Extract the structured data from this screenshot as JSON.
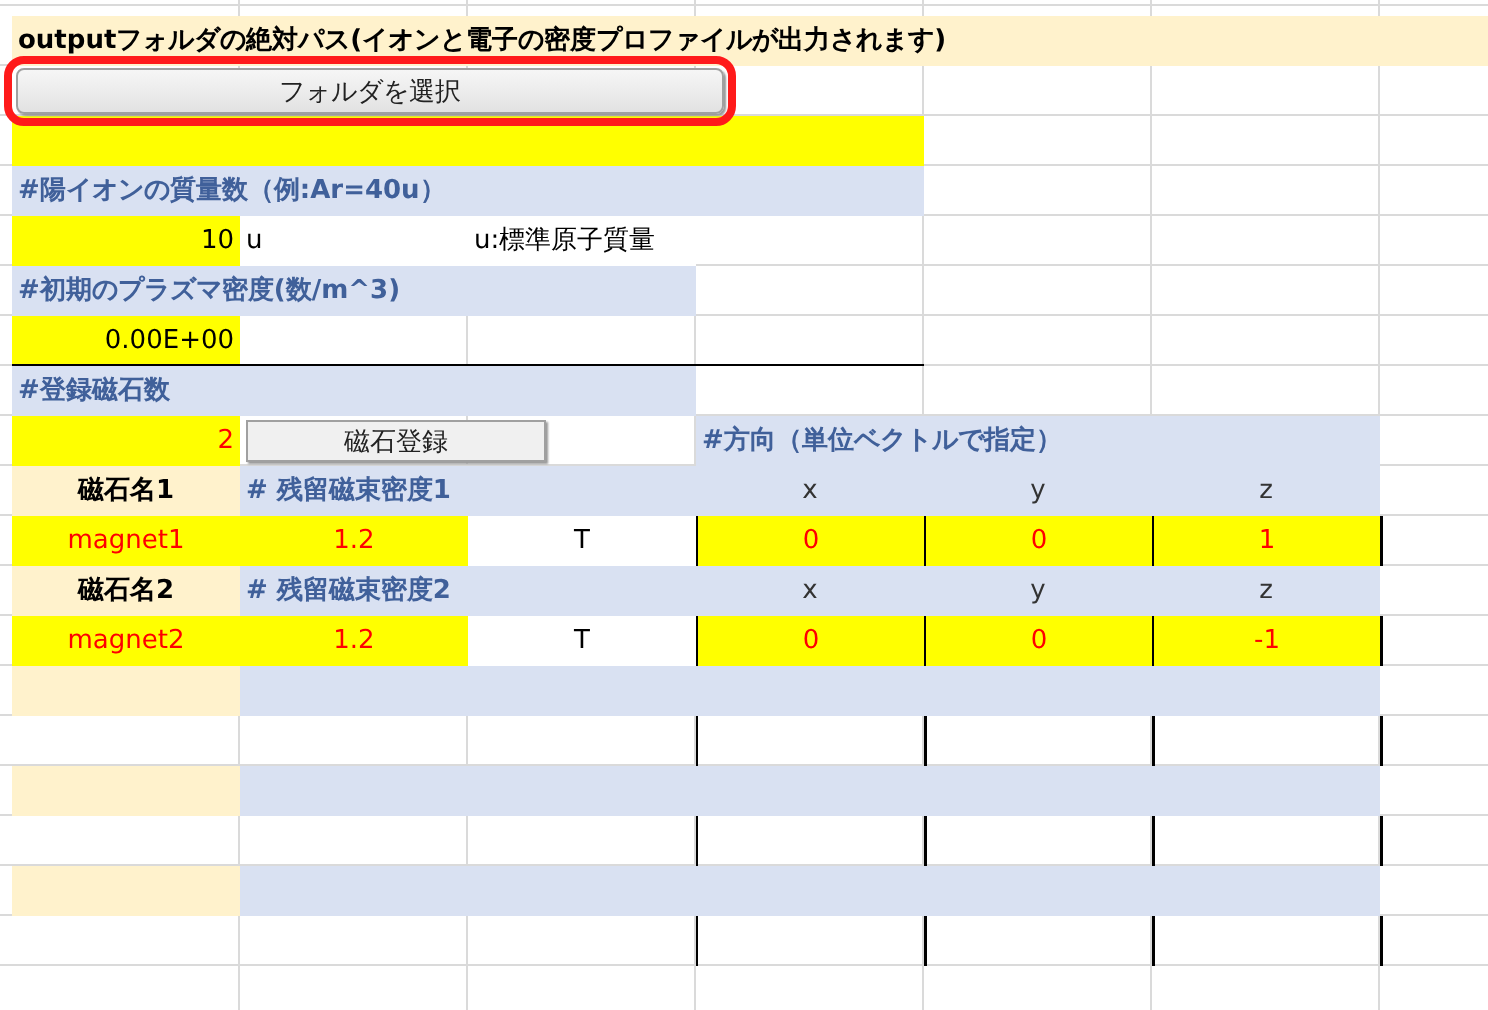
{
  "sheet": {
    "rows": [
      {
        "cells": [
          {
            "kind": "title",
            "text": "outputフォルダの絶対パス(イオンと電子の密度プロファイルが出力されます)"
          },
          {
            "kind": "title"
          },
          {
            "kind": "title"
          },
          {
            "kind": "title"
          },
          {
            "kind": "title"
          },
          {
            "kind": "title"
          },
          {
            "kind": "title"
          }
        ]
      },
      {
        "button": {
          "kind": "folder",
          "label": "フォルダを選択",
          "highlighted": true
        }
      },
      {
        "cells": [
          {
            "kind": "input"
          },
          {
            "kind": "input"
          },
          {
            "kind": "input"
          },
          {
            "kind": "input"
          }
        ]
      },
      {
        "cells": [
          {
            "kind": "header",
            "text": "#陽イオンの質量数（例:Ar=40u）"
          },
          {
            "kind": "header"
          },
          {
            "kind": "header"
          },
          {
            "kind": "header"
          }
        ]
      },
      {
        "cells": [
          {
            "kind": "input",
            "text": "10"
          },
          {
            "kind": "text",
            "text": "u"
          },
          {
            "kind": "text",
            "text": "u:標準原子質量"
          }
        ]
      },
      {
        "cells": [
          {
            "kind": "header",
            "text": "#初期のプラズマ密度(数/m^3)"
          },
          {
            "kind": "header"
          },
          {
            "kind": "header"
          }
        ]
      },
      {
        "cells": [
          {
            "kind": "input_ruled",
            "text": "0.00E+00"
          },
          {
            "kind": "plain_ruled"
          },
          {
            "kind": "plain_ruled"
          },
          {
            "kind": "plain_ruled"
          }
        ]
      },
      {
        "cells": [
          {
            "kind": "header",
            "text": "#登録磁石数"
          },
          {
            "kind": "header"
          },
          {
            "kind": "header"
          }
        ]
      },
      {
        "cells": [
          {
            "kind": "count",
            "text": "2"
          },
          {
            "kind": "plain"
          },
          {
            "kind": "plain"
          },
          {
            "kind": "header",
            "text": "#方向（単位ベクトルで指定）"
          },
          {
            "kind": "header"
          },
          {
            "kind": "header"
          }
        ],
        "button": {
          "kind": "register",
          "label": "磁石登録",
          "highlighted": false
        }
      },
      {
        "cells": [
          {
            "kind": "name_label",
            "text": "磁石名1"
          },
          {
            "kind": "header",
            "text": "# 残留磁束密度1"
          },
          {
            "kind": "header"
          },
          {
            "kind": "axis",
            "text": "x"
          },
          {
            "kind": "axis",
            "text": "y"
          },
          {
            "kind": "axis",
            "text": "z"
          }
        ]
      },
      {
        "cells": [
          {
            "kind": "value",
            "text": "magnet1"
          },
          {
            "kind": "value",
            "text": "1.2"
          },
          {
            "kind": "unit",
            "text": "T"
          },
          {
            "kind": "vector",
            "text": "0"
          },
          {
            "kind": "vector",
            "text": "0"
          },
          {
            "kind": "vector",
            "text": "1"
          }
        ]
      },
      {
        "cells": [
          {
            "kind": "name_label",
            "text": "磁石名2"
          },
          {
            "kind": "header",
            "text": "# 残留磁束密度2"
          },
          {
            "kind": "header"
          },
          {
            "kind": "axis",
            "text": "x"
          },
          {
            "kind": "axis",
            "text": "y"
          },
          {
            "kind": "axis",
            "text": "z"
          }
        ]
      },
      {
        "cells": [
          {
            "kind": "value",
            "text": "magnet2"
          },
          {
            "kind": "value",
            "text": "1.2"
          },
          {
            "kind": "unit",
            "text": "T"
          },
          {
            "kind": "vector",
            "text": "0"
          },
          {
            "kind": "vector",
            "text": "0"
          },
          {
            "kind": "vector",
            "text": "-1"
          }
        ]
      },
      {
        "cells": [
          {
            "kind": "name_label"
          },
          {
            "kind": "header"
          },
          {
            "kind": "header"
          },
          {
            "kind": "header"
          },
          {
            "kind": "header"
          },
          {
            "kind": "header"
          }
        ]
      },
      {
        "cells": [
          {
            "kind": "plain"
          },
          {
            "kind": "plain"
          },
          {
            "kind": "plain"
          },
          {
            "kind": "boxed"
          },
          {
            "kind": "boxed"
          },
          {
            "kind": "boxed"
          }
        ]
      },
      {
        "cells": [
          {
            "kind": "name_label"
          },
          {
            "kind": "header"
          },
          {
            "kind": "header"
          },
          {
            "kind": "header"
          },
          {
            "kind": "header"
          },
          {
            "kind": "header"
          }
        ]
      },
      {
        "cells": [
          {
            "kind": "plain"
          },
          {
            "kind": "plain"
          },
          {
            "kind": "plain"
          },
          {
            "kind": "boxed"
          },
          {
            "kind": "boxed"
          },
          {
            "kind": "boxed"
          }
        ]
      },
      {
        "cells": [
          {
            "kind": "name_label"
          },
          {
            "kind": "header"
          },
          {
            "kind": "header"
          },
          {
            "kind": "header"
          },
          {
            "kind": "header"
          },
          {
            "kind": "header"
          }
        ]
      },
      {
        "cells": [
          {
            "kind": "plain"
          },
          {
            "kind": "plain"
          },
          {
            "kind": "plain"
          },
          {
            "kind": "boxed"
          },
          {
            "kind": "boxed"
          },
          {
            "kind": "boxed"
          }
        ]
      }
    ]
  }
}
